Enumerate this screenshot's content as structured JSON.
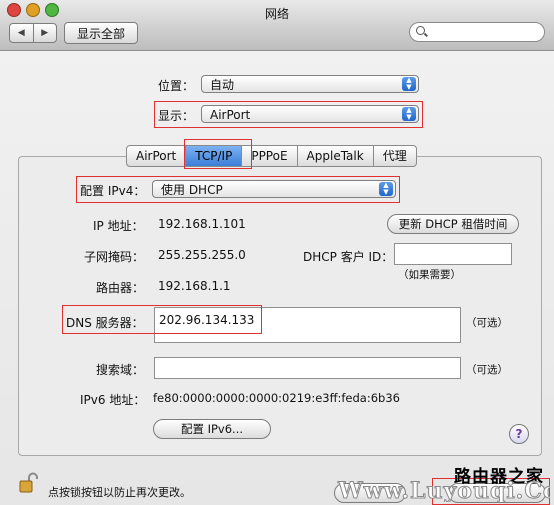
{
  "window": {
    "title": "网络"
  },
  "toolbar": {
    "back_label": "◀",
    "forward_label": "▶",
    "show_all_label": "显示全部",
    "search_placeholder": ""
  },
  "location": {
    "label": "位置：",
    "value": "自动"
  },
  "show": {
    "label": "显示：",
    "value": "AirPort"
  },
  "tabs": [
    {
      "label": "AirPort"
    },
    {
      "label": "TCP/IP"
    },
    {
      "label": "PPPoE"
    },
    {
      "label": "AppleTalk"
    },
    {
      "label": "代理"
    }
  ],
  "tcpip": {
    "configure_label": "配置 IPv4：",
    "configure_value": "使用 DHCP",
    "ip_label": "IP 地址：",
    "ip_value": "192.168.1.101",
    "renew_button": "更新 DHCP 租借时间",
    "subnet_label": "子网掩码：",
    "subnet_value": "255.255.255.0",
    "client_id_label": "DHCP 客户 ID：",
    "client_id_value": "",
    "client_id_hint": "（如果需要）",
    "router_label": "路由器：",
    "router_value": "192.168.1.1",
    "dns_label": "DNS 服务器：",
    "dns_value": "202.96.134.133",
    "dns_optional": "（可选）",
    "search_domains_label": "搜索域：",
    "search_domains_value": "",
    "search_optional": "（可选）",
    "ipv6_label": "IPv6 地址：",
    "ipv6_value": "fe80:0000:0000:0000:0219:e3ff:feda:6b36",
    "configure_ipv6_button": "配置 IPv6...",
    "help_label": "?"
  },
  "footer": {
    "lock_text": "点按锁按钮以防止再次更改。",
    "watermark_line1": "路由器之家",
    "watermark_line2": "Www.Luyouqi.Com"
  },
  "colors": {
    "highlight": "#e03030",
    "selected_tab": "#3b7ed8",
    "close": "#e0443e",
    "minimize": "#dfa023",
    "zoom": "#4fb641"
  }
}
